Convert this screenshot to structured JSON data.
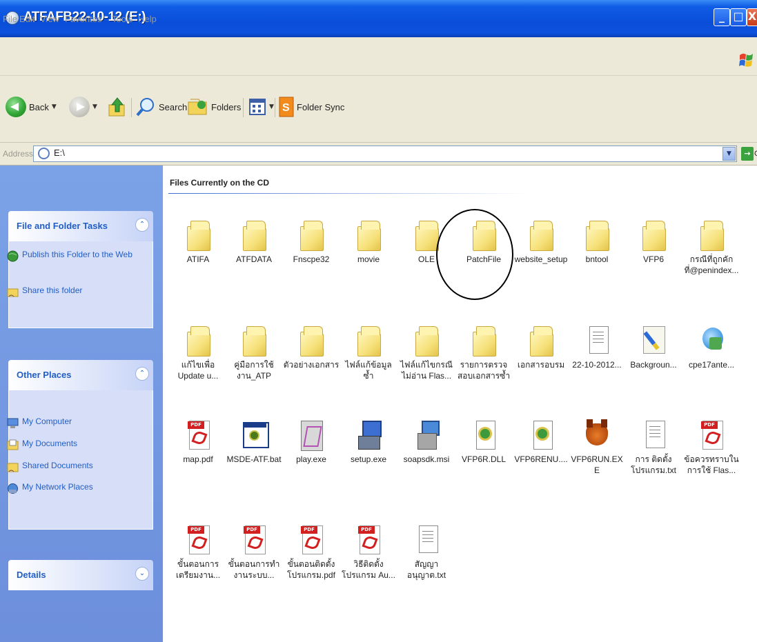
{
  "window": {
    "title": "ATFAFB22-10-12 (E:)",
    "min_label": "_",
    "max_label": "□",
    "close_label": "X"
  },
  "menu": [
    "File",
    "Edit",
    "View",
    "Favorites",
    "Tools",
    "Help"
  ],
  "toolbar": {
    "back": "Back",
    "search": "Search",
    "folders": "Folders",
    "folder_sync": "Folder Sync"
  },
  "address": {
    "label": "Address",
    "value": "E:\\",
    "go": "Go"
  },
  "tasks": {
    "file_folder": {
      "title": "File and Folder Tasks",
      "items": [
        "Publish this Folder to the Web",
        "Share this folder"
      ]
    },
    "other_places": {
      "title": "Other Places",
      "items": [
        "My Computer",
        "My Documents",
        "Shared Documents",
        "My Network Places"
      ]
    },
    "details": {
      "title": "Details"
    }
  },
  "content": {
    "group_header": "Files Currently on the CD",
    "items": [
      {
        "name": "ATIFA",
        "type": "folder"
      },
      {
        "name": "ATFDATA",
        "type": "folder"
      },
      {
        "name": "Fnscpe32",
        "type": "folder"
      },
      {
        "name": "movie",
        "type": "folder"
      },
      {
        "name": "OLE",
        "type": "folder"
      },
      {
        "name": "PatchFile",
        "type": "folder"
      },
      {
        "name": "website_setup",
        "type": "folder"
      },
      {
        "name": "bntool",
        "type": "folder"
      },
      {
        "name": "VFP6",
        "type": "folder"
      },
      {
        "name": "กรณีที่ถูกคัก ที่@penindex...",
        "type": "folder"
      },
      {
        "name": "แก้ไขเพื่อ Update u...",
        "type": "folder"
      },
      {
        "name": "คู่มือการใช้ งาน_ATP",
        "type": "folder"
      },
      {
        "name": "ตัวอย่างเอกสาร",
        "type": "folder"
      },
      {
        "name": "ไฟล์แก้ข้อมูล ซ้ำ",
        "type": "folder"
      },
      {
        "name": "ไฟล์แก้ไขกรณี ไม่อ่าน Flas...",
        "type": "folder"
      },
      {
        "name": "รายการตรวจ สอบเอกสารซ้ำ",
        "type": "folder"
      },
      {
        "name": "เอกสารอบรม",
        "type": "folder"
      },
      {
        "name": "22-10-2012...",
        "type": "doc"
      },
      {
        "name": "Backgroun...",
        "type": "img"
      },
      {
        "name": "cpe17ante...",
        "type": "html"
      },
      {
        "name": "map.pdf",
        "type": "pdf"
      },
      {
        "name": "MSDE-ATF.bat",
        "type": "bat"
      },
      {
        "name": "play.exe",
        "type": "exe-gray"
      },
      {
        "name": "setup.exe",
        "type": "setup"
      },
      {
        "name": "soapsdk.msi",
        "type": "msi"
      },
      {
        "name": "VFP6R.DLL",
        "type": "dll"
      },
      {
        "name": "VFP6RENU....",
        "type": "dll"
      },
      {
        "name": "VFP6RUN.EXE",
        "type": "fox"
      },
      {
        "name": "การ ติดตั้งโปรแกรม.txt",
        "type": "doc"
      },
      {
        "name": "ข้อควรทราบใน การใช้ Flas...",
        "type": "pdf"
      },
      {
        "name": "ขั้นตอนการ เตรียมงาน...",
        "type": "pdf"
      },
      {
        "name": "ขั้นตอนการทำ งานระบบ...",
        "type": "pdf"
      },
      {
        "name": "ขั้นตอนติดตั้ง โปรแกรม.pdf",
        "type": "pdf"
      },
      {
        "name": "วิธีติดตั้ง โปรแกรม Au...",
        "type": "pdf"
      },
      {
        "name": "สัญญาอนุญาต.txt",
        "type": "doc"
      }
    ]
  },
  "colors": {
    "title_bar": "#0a4ed8",
    "task_pane": "#7ba2e7",
    "task_link": "#215dc6",
    "chrome": "#ece9d8"
  }
}
